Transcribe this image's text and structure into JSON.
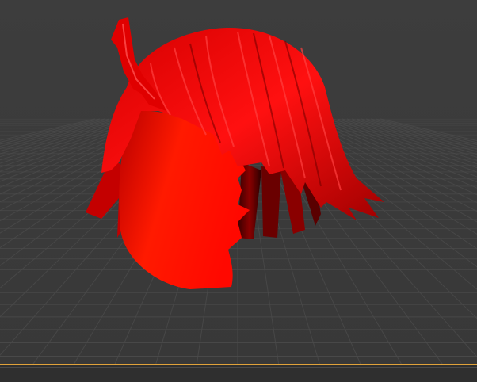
{
  "viewport": {
    "background_color": "#3b3b3b",
    "grid_color": "#4b4b4b",
    "model_color": "#ff0000",
    "model_dark_color": "#5a0000",
    "timeline_marker_color": "#e0a23a"
  },
  "scene": {
    "object": "red-hair-mesh",
    "view": "perspective"
  }
}
